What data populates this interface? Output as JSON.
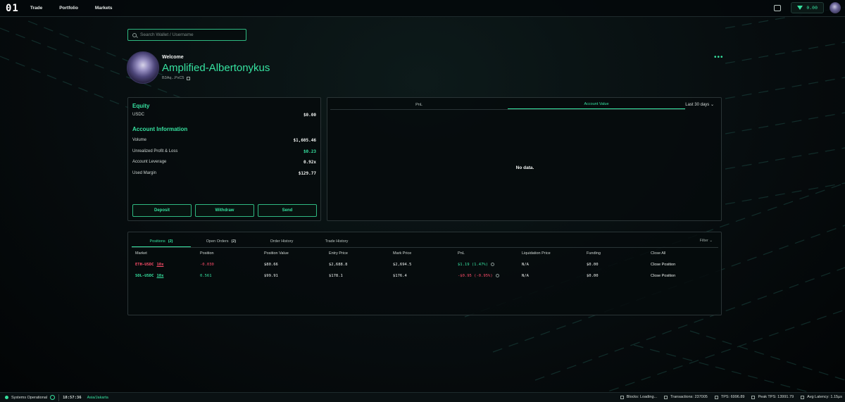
{
  "nav": {
    "logo": "01",
    "items": [
      {
        "label": "Trade"
      },
      {
        "label": "Portfolio"
      },
      {
        "label": "Markets"
      }
    ],
    "balance": "0.00"
  },
  "search": {
    "placeholder": "Search Wallet / Username"
  },
  "profile": {
    "welcome": "Welcome",
    "username": "Amplified-Albertonykus",
    "address": "B3Aq...PxC5"
  },
  "account": {
    "equity_title": "Equity",
    "equity_rows": [
      {
        "label": "USDC",
        "value": "$0.00"
      }
    ],
    "info_title": "Account Information",
    "info_rows": [
      {
        "label": "Volume",
        "value": "$1,605.46"
      },
      {
        "label": "Unrealized Profit & Loss",
        "value": "$0.23"
      },
      {
        "label": "Account Leverage",
        "value": "0.92x"
      },
      {
        "label": "Used Margin",
        "value": "$129.77"
      }
    ],
    "buttons": {
      "deposit": "Deposit",
      "withdraw": "Withdraw",
      "send": "Send"
    }
  },
  "chart": {
    "tabs": [
      "PnL",
      "Account Value"
    ],
    "active_tab": "Account Value",
    "range": "Last 30 days",
    "empty_message": "No data."
  },
  "positions": {
    "tabs": [
      {
        "label": "Positions",
        "badge": "(2)"
      },
      {
        "label": "Open Orders",
        "badge": "(2)"
      },
      {
        "label": "Order History",
        "badge": ""
      },
      {
        "label": "Trade History",
        "badge": ""
      }
    ],
    "filter_label": "Filter",
    "columns": [
      "Market",
      "Position",
      "Position Value",
      "Entry Price",
      "Mark Price",
      "PnL",
      "Liquidation Price",
      "Funding",
      "Close All"
    ],
    "rows": [
      {
        "market": "ETH-USDC",
        "leverage": "10x",
        "side_color": "#ff4d6a",
        "position": "-0.030",
        "position_value": "$80.66",
        "entry_price": "$2,688.8",
        "mark_price": "$2,694.5",
        "pnl": "$1.19 (1.47%)",
        "pnl_color": "#36e2a0",
        "liquidation_price": "N/A",
        "funding": "$0.00",
        "action": "Close Position"
      },
      {
        "market": "SOL-USDC",
        "leverage": "10x",
        "side_color": "#36e2a0",
        "position": "0.561",
        "position_value": "$99.91",
        "entry_price": "$178.1",
        "mark_price": "$176.4",
        "pnl": "-$0.95 (-0.95%)",
        "pnl_color": "#ff4d6a",
        "liquidation_price": "N/A",
        "funding": "$0.00",
        "action": "Close Position"
      }
    ]
  },
  "footer": {
    "status": "Systems Operational",
    "time": "18:57:36",
    "timezone": "Asia/Jakarta",
    "blocks": "Blocks: Loading...",
    "transactions": "Transactions: 237005",
    "tps": "TPS: 6996.89",
    "peak_tps": "Peak TPS: 13991.79",
    "latency": "Avg Latency: 1.15μs"
  },
  "colors": {
    "accent": "#36e2a0",
    "negative": "#ff4d6a",
    "background": "#070d0f"
  }
}
